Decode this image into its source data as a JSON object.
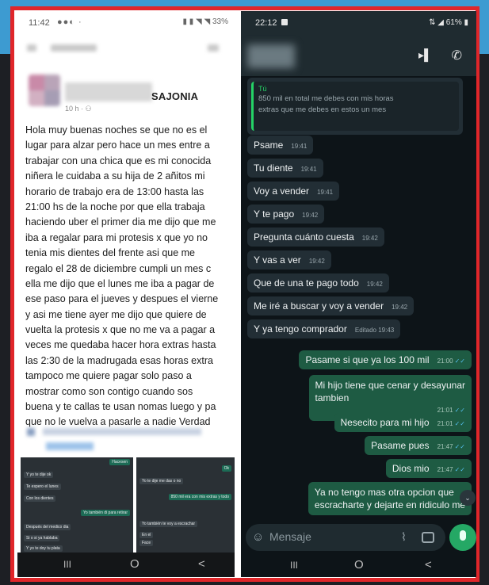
{
  "left_phone": {
    "status": {
      "time": "11:42",
      "battery": "33%"
    },
    "poster_name": "SAJONIA",
    "post_meta": "10 h ·",
    "post_lines": [
      "Hola muy buenas noches se que no es el",
      "lugar para alzar pero hace un mes entre a",
      "trabajar con una chica que es mi conocida",
      "niñera le cuidaba a su hija de 2 añitos mi",
      "horario de trabajo era de 13:00 hasta las",
      "21:00 hs de la noche por que ella trabaja",
      "haciendo uber el primer dia me dijo que me",
      "iba a regalar para mi protesis x que yo no",
      "tenia mis dientes del frente asi que me",
      "regalo el 28 de diciembre cumpli un mes c",
      "ella me dijo que el lunes me iba a pagar de",
      "ese paso para el jueves y despues el vierne",
      "y asi me tiene ayer me dijo que quiere de",
      "vuelta la protesis x que no me va a pagar a",
      "veces me quedaba hacer hora extras hasta",
      "las 2:30 de la madrugada esas horas extra",
      "tampoco me quiere pagar solo paso a",
      "mostrar como son contigo cuando sos",
      "buena y te callas te usan nomas luego y pa",
      "que no le vuelva a pasarle a nadie Verdad"
    ],
    "thumb1": [
      {
        "text": "Hacesen",
        "dir": "out"
      },
      {
        "text": "Y yo te dije ok",
        "dir": "in"
      },
      {
        "text": "Te espero el lunes",
        "dir": "in"
      },
      {
        "text": "Con los dientes",
        "dir": "in"
      },
      {
        "text": "Yo también di para retirar",
        "dir": "out"
      },
      {
        "text": "Después del medico dia",
        "dir": "in"
      },
      {
        "text": "Si o si ya hablaba",
        "dir": "in"
      },
      {
        "text": "Y yo te doy tu plata",
        "dir": "in"
      }
    ],
    "thumb2": [
      {
        "text": "Ok",
        "dir": "out"
      },
      {
        "text": "Yo te dije me das o no",
        "dir": "in"
      },
      {
        "text": "850 mil era con mis extras y todo",
        "dir": "out"
      },
      {
        "text": "Yo también te voy a escrachar",
        "dir": "in"
      },
      {
        "text": "En el",
        "dir": "in"
      },
      {
        "text": "Face",
        "dir": "in"
      }
    ],
    "nav": {
      "recents": "III",
      "home": "O",
      "back": "<"
    }
  },
  "right_phone": {
    "status": {
      "time": "22:12",
      "battery": "61%"
    },
    "quoted": {
      "author": "Tú",
      "text_lines": [
        "850 mil en total me debes con mis horas",
        "extras que me debes en estos un mes"
      ]
    },
    "messages": [
      {
        "text": "Psame",
        "time": "19:41",
        "dir": "in"
      },
      {
        "text": "Tu diente",
        "time": "19:41",
        "dir": "in"
      },
      {
        "text": "Voy a vender",
        "time": "19:41",
        "dir": "in"
      },
      {
        "text": "Y te pago",
        "time": "19:42",
        "dir": "in"
      },
      {
        "text": "Pregunta cuánto cuesta",
        "time": "19:42",
        "dir": "in"
      },
      {
        "text": "Y vas a ver",
        "time": "19:42",
        "dir": "in"
      },
      {
        "text": "Que de una te pago todo",
        "time": "19:42",
        "dir": "in"
      },
      {
        "text": "Me iré a buscar y voy a vender",
        "time": "19:42",
        "dir": "in"
      },
      {
        "text": "Y ya tengo comprador",
        "time": "Editado 19:43",
        "dir": "in"
      },
      {
        "text": "Pasame si que ya los 100 mil",
        "time": "21:00",
        "dir": "out"
      },
      {
        "text": "Mi hijo tiene que cenar y desayunar",
        "text2": "tambien",
        "time": "21:01",
        "dir": "out"
      },
      {
        "text": "Nesecito para mi hijo",
        "time": "21:01",
        "dir": "out"
      },
      {
        "text": "Pasame pues",
        "time": "21:47",
        "dir": "out"
      },
      {
        "text": "Dios mio",
        "time": "21:47",
        "dir": "out"
      },
      {
        "text": "Ya no tengo mas otra opcion que",
        "text2": "escracharte y dejarte en ridiculo me",
        "time": "",
        "dir": "out"
      }
    ],
    "composer": {
      "placeholder": "Mensaje"
    },
    "nav": {
      "recents": "III",
      "home": "O",
      "back": "<"
    }
  },
  "colors": {
    "frame_border": "#e0262a",
    "whatsapp_out": "#1e5b43",
    "whatsapp_in": "#222e35",
    "whatsapp_green": "#25d366",
    "backdrop_blue": "#3d9bd1"
  }
}
